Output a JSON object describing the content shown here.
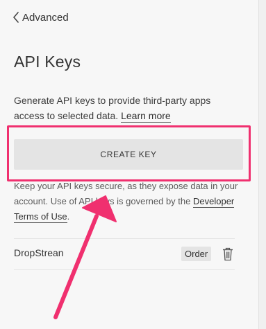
{
  "nav": {
    "back_label": "Advanced"
  },
  "page": {
    "title": "API Keys"
  },
  "intro": {
    "text": "Generate API keys to provide third-party apps access to selected data.",
    "link_label": "Learn more"
  },
  "create_button": {
    "label": "CREATE KEY"
  },
  "notice": {
    "text": "Keep your API keys secure, as they expose data in your account. Use of API keys is governed by the",
    "link_label": "Developer Terms of Use",
    "end": "."
  },
  "keys": [
    {
      "name": "DropStrean",
      "scope": "Order"
    }
  ],
  "colors": {
    "annotation": "#f0306f",
    "background": "#f7f7f7",
    "button": "#e4e4e4"
  },
  "icons": {
    "back": "chevron-left-icon",
    "delete": "trash-icon"
  }
}
